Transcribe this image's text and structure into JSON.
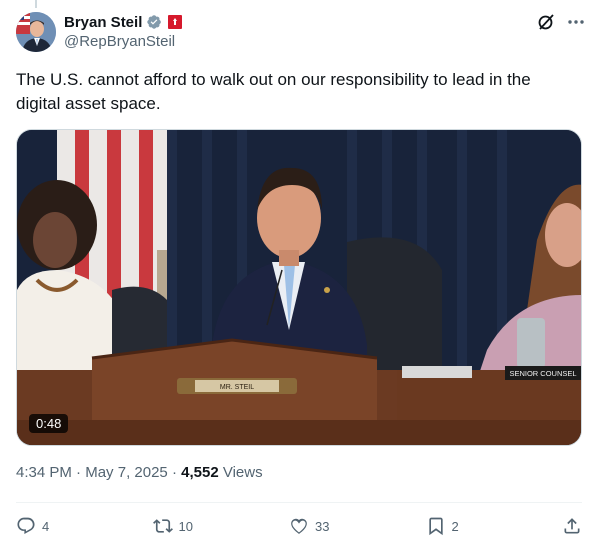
{
  "author": {
    "display_name": "Bryan Steil",
    "handle": "@RepBryanSteil"
  },
  "icons": {
    "verified": "verified-badge-icon",
    "affiliation": "house-affiliation-icon",
    "grok": "grok-icon",
    "more": "more-options-icon",
    "reply": "reply-icon",
    "retweet": "retweet-icon",
    "like": "like-icon",
    "bookmark": "bookmark-icon",
    "share": "share-icon"
  },
  "tweet": {
    "text": "The U.S. cannot afford to walk out on our responsibility to lead in the digital asset space.",
    "media": {
      "duration": "0:48",
      "nameplate": "MR. STEIL",
      "nameplate_right": "SENIOR COUNSEL"
    },
    "time": "4:34 PM",
    "date": "May 7, 2025",
    "views_count": "4,552",
    "views_label": "Views"
  },
  "engagement": {
    "replies": "4",
    "retweets": "10",
    "likes": "33",
    "bookmarks": "2"
  },
  "colors": {
    "text_primary": "#0f1419",
    "text_secondary": "#536471",
    "verified_blue": "#1d9bf0",
    "divider": "#eff3f4"
  }
}
